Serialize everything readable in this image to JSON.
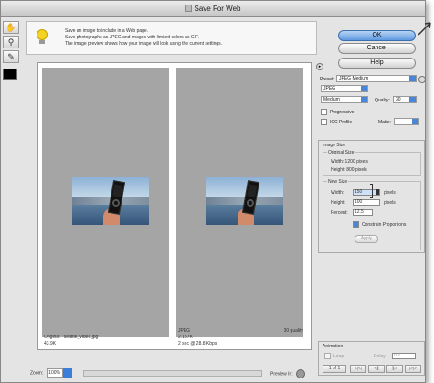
{
  "window": {
    "title": "Save For Web"
  },
  "hint": {
    "line1": "Save an image to include in a Web page.",
    "line2": "Save photographs as JPEG and images with limited colors as GIF.",
    "line3": "The image preview shows how your image will look using the current settings."
  },
  "buttons": {
    "ok": "OK",
    "cancel": "Cancel",
    "help": "Help"
  },
  "settings": {
    "preset_label": "Preset:",
    "preset_value": "JPEG Medium",
    "format_value": "JPEG",
    "compression_value": "Medium",
    "quality_label": "Quality:",
    "quality_value": "30",
    "progressive_label": "Progressive",
    "icc_label": "ICC Profile",
    "matte_label": "Matte:"
  },
  "image_size": {
    "section_title": "Image Size",
    "original_title": "Original Size",
    "orig_width": "Width:  1200 pixels",
    "orig_height": "Height:  800 pixels",
    "new_title": "New Size",
    "width_label": "Width:",
    "width_value": "150",
    "height_label": "Height:",
    "height_value": "100",
    "percent_label": "Percent:",
    "percent_value": "12.5",
    "unit": "pixels",
    "constrain_label": "Constrain Proportions",
    "apply_label": "Apply"
  },
  "preview": {
    "original_caption": "Original: \"seattle_video.jpg\"",
    "original_size": "43.9K",
    "optimized_format": "JPEG",
    "optimized_size": "2.157K",
    "optimized_time": "2 sec @ 28.8 Kbps",
    "optimized_quality": "30 quality"
  },
  "zoom": {
    "label": "Zoom:",
    "value": "100%"
  },
  "preview_in": {
    "label": "Preview In:"
  },
  "animation": {
    "section_title": "Animation",
    "loop_label": "Loop",
    "delay_label": "Delay:",
    "delay_value": "0.2",
    "frame_counter": "1 of 1",
    "nav_first": "◁◁",
    "nav_prev": "◁|",
    "nav_next": "|▷",
    "nav_last": "▷▷"
  },
  "colors": {
    "accent": "#4a86d8",
    "ok_button": "#7fb0ea"
  },
  "icons": [
    "hand-icon",
    "zoom-icon",
    "eyedropper-icon",
    "lightbulb-icon",
    "panel-menu-icon",
    "chevron-down-icon"
  ]
}
